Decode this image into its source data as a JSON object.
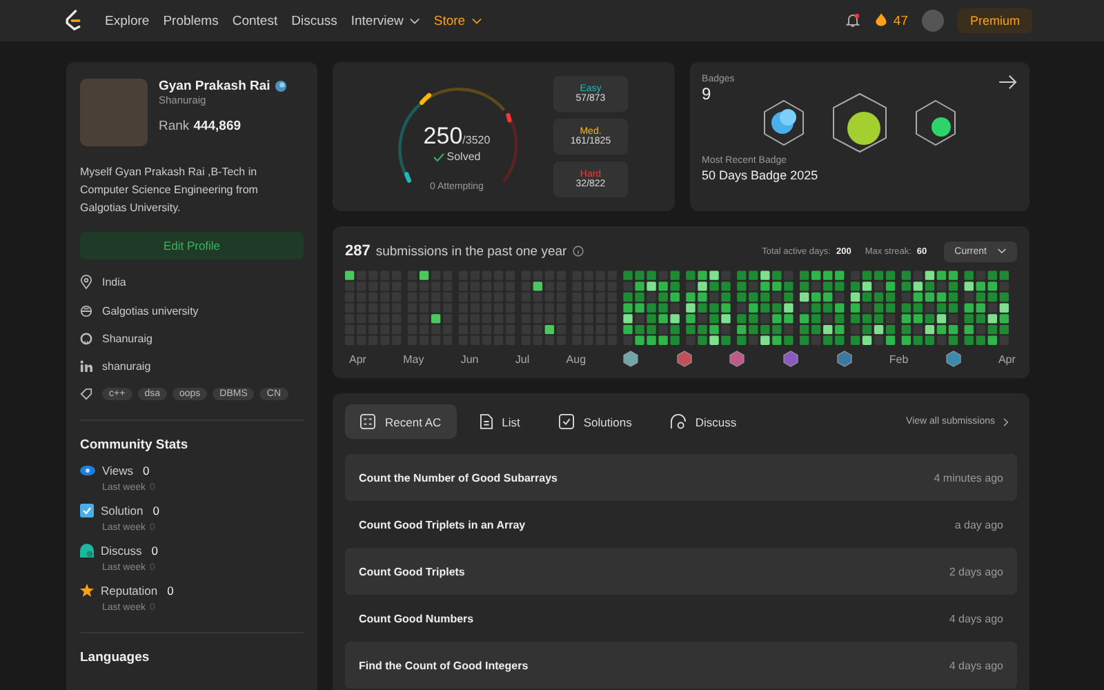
{
  "nav": {
    "items": [
      {
        "label": "Explore",
        "kind": "plain",
        "has_menu": false
      },
      {
        "label": "Problems",
        "kind": "plain",
        "has_menu": false
      },
      {
        "label": "Contest",
        "kind": "plain",
        "has_menu": false
      },
      {
        "label": "Discuss",
        "kind": "plain",
        "has_menu": false
      },
      {
        "label": "Interview",
        "kind": "plain",
        "has_menu": true
      },
      {
        "label": "Store",
        "kind": "highlight",
        "has_menu": true
      }
    ],
    "streak": "47",
    "premium": "Premium"
  },
  "profile": {
    "name": "Gyan Prakash Rai",
    "username": "Shanuraig",
    "rank_label": "Rank",
    "rank": "444,869",
    "bio": "Myself Gyan Prakash Rai ,B-Tech in Computer Science Engineering from Galgotias University.",
    "edit_button": "Edit Profile",
    "details": [
      {
        "kind": "location",
        "text": "India"
      },
      {
        "kind": "school",
        "text": "Galgotias university"
      },
      {
        "kind": "github",
        "text": "Shanuraig"
      },
      {
        "kind": "linkedin",
        "text": "shanuraig"
      }
    ],
    "skills": [
      "c++",
      "dsa",
      "oops",
      "DBMS",
      "CN"
    ]
  },
  "community": {
    "title": "Community Stats",
    "stats": [
      {
        "kind": "views",
        "label": "Views",
        "value": "0",
        "sub": "Last week",
        "sub_value": "0"
      },
      {
        "kind": "solution",
        "label": "Solution",
        "value": "0",
        "sub": "Last week",
        "sub_value": "0"
      },
      {
        "kind": "discuss",
        "label": "Discuss",
        "value": "0",
        "sub": "Last week",
        "sub_value": "0"
      },
      {
        "kind": "reputation",
        "label": "Reputation",
        "value": "0",
        "sub": "Last week",
        "sub_value": "0"
      }
    ]
  },
  "languages_title": "Languages",
  "solved": {
    "count": "250",
    "total": "/3520",
    "label": "Solved",
    "attempting": "0 Attempting",
    "difficulties": [
      {
        "label": "Easy",
        "value": "57/873",
        "color": "#1cbaba"
      },
      {
        "label": "Med.",
        "value": "161/1825",
        "color": "#ffb700"
      },
      {
        "label": "Hard",
        "value": "32/822",
        "color": "#f63737"
      }
    ]
  },
  "badges": {
    "title": "Badges",
    "count": "9",
    "recent_label": "Most Recent Badge",
    "recent": "50 Days Badge 2025"
  },
  "calendar": {
    "count": "287",
    "title": "submissions in the past one year",
    "active_label": "Total active days:",
    "active": "200",
    "streak_label": "Max streak:",
    "streak": "60",
    "period": "Current",
    "timeline": [
      {
        "kind": "month",
        "label": "Apr"
      },
      {
        "kind": "month",
        "label": "May"
      },
      {
        "kind": "month",
        "label": "Jun"
      },
      {
        "kind": "month",
        "label": "Jul"
      },
      {
        "kind": "month",
        "label": "Aug"
      },
      {
        "kind": "badge",
        "color": "#6fa8a8"
      },
      {
        "kind": "badge",
        "color": "#c0505a"
      },
      {
        "kind": "badge",
        "color": "#c05a8a"
      },
      {
        "kind": "badge",
        "color": "#8a5ac0"
      },
      {
        "kind": "badge",
        "color": "#3a7aa0"
      },
      {
        "kind": "month",
        "label": "Feb"
      },
      {
        "kind": "badge",
        "color": "#3a8ab0"
      },
      {
        "kind": "month",
        "label": "Apr"
      }
    ]
  },
  "submissions": {
    "tabs": [
      {
        "label": "Recent AC",
        "kind": "recent",
        "selected": true
      },
      {
        "label": "List",
        "kind": "list",
        "selected": false
      },
      {
        "label": "Solutions",
        "kind": "solutions",
        "selected": false
      },
      {
        "label": "Discuss",
        "kind": "discuss",
        "selected": false
      }
    ],
    "view_all": "View all submissions",
    "rows": [
      {
        "title": "Count the Number of Good Subarrays",
        "time": "4 minutes ago"
      },
      {
        "title": "Count Good Triplets in an Array",
        "time": "a day ago"
      },
      {
        "title": "Count Good Triplets",
        "time": "2 days ago"
      },
      {
        "title": "Count Good Numbers",
        "time": "4 days ago"
      },
      {
        "title": "Find the Count of Good Integers",
        "time": "4 days ago"
      }
    ]
  }
}
